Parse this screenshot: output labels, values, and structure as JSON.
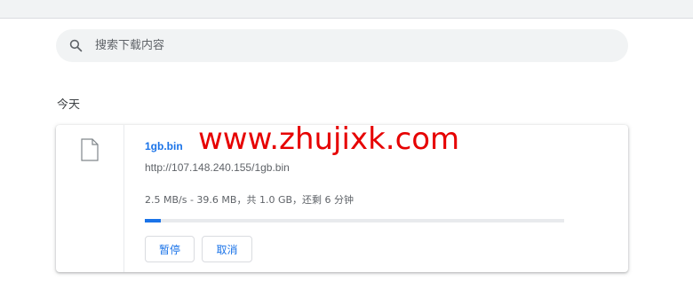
{
  "search": {
    "placeholder": "搜索下载内容",
    "icon": "search-icon"
  },
  "section": {
    "title": "今天"
  },
  "download": {
    "file_name": "1gb.bin",
    "url": "http://107.148.240.155/1gb.bin",
    "status": "2.5 MB/s - 39.6 MB，共 1.0 GB，还剩 6 分钟",
    "progress_percent": 3.9,
    "pause_label": "暂停",
    "cancel_label": "取消",
    "file_icon": "file-icon"
  },
  "watermark": {
    "text": "www.zhujixk.com"
  },
  "colors": {
    "accent": "#1a73e8",
    "watermark": "#e60000",
    "search_bg": "#f1f3f4"
  }
}
